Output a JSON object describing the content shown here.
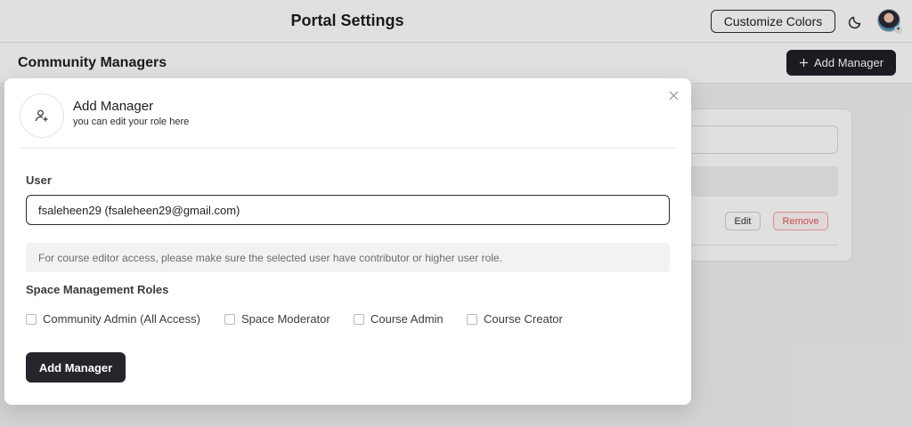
{
  "header": {
    "title": "Portal Settings",
    "customize_label": "Customize Colors",
    "theme_icon": "moon-icon",
    "avatar_icon": "user-avatar"
  },
  "subheader": {
    "title": "Community Managers",
    "add_label": "Add Manager",
    "add_icon": "plus-icon"
  },
  "background_card": {
    "edit_label": "Edit",
    "remove_label": "Remove"
  },
  "modal": {
    "icon": "user-plus-icon",
    "title": "Add Manager",
    "subtitle": "you can edit your role here",
    "close_icon": "close-icon",
    "user_label": "User",
    "user_value": "fsaleheen29 (fsaleheen29@gmail.com)",
    "notice": "For course editor access, please make sure the selected user have contributor or higher user role.",
    "roles_label": "Space Management Roles",
    "roles": [
      {
        "label": "Community Admin (All Access)",
        "checked": false
      },
      {
        "label": "Space Moderator",
        "checked": false
      },
      {
        "label": "Course Admin",
        "checked": false
      },
      {
        "label": "Course Creator",
        "checked": false
      }
    ],
    "submit_label": "Add Manager"
  },
  "colors": {
    "primary_button": "#25262c",
    "remove_red": "#e05a5a",
    "overlay": "rgba(0,0,0,0.12)"
  }
}
